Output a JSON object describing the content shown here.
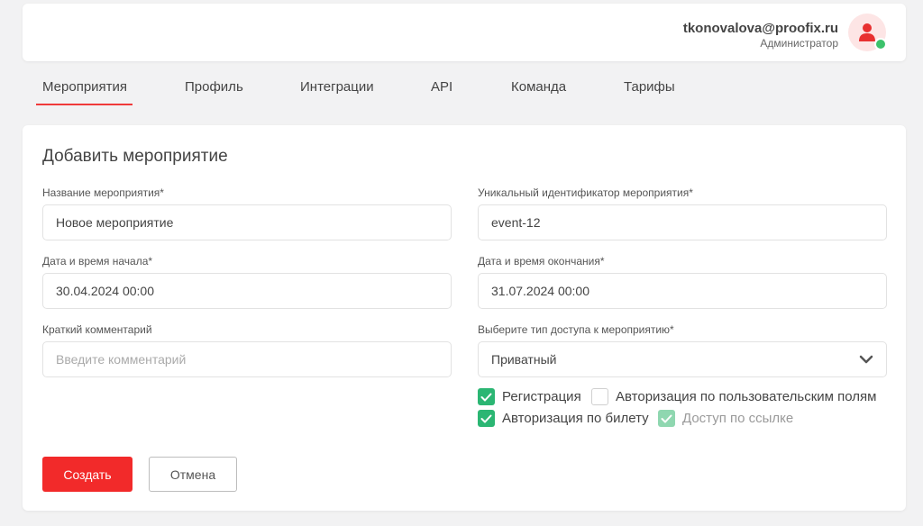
{
  "header": {
    "user_email": "tkonovalova@proofix.ru",
    "user_role": "Администратор",
    "online_status_color": "#3cc26b",
    "avatar_icon": "user-icon"
  },
  "tabs": [
    {
      "label": "Мероприятия",
      "active": true
    },
    {
      "label": "Профиль",
      "active": false
    },
    {
      "label": "Интеграции",
      "active": false
    },
    {
      "label": "API",
      "active": false
    },
    {
      "label": "Команда",
      "active": false
    },
    {
      "label": "Тарифы",
      "active": false
    }
  ],
  "form": {
    "title": "Добавить мероприятие",
    "event_name": {
      "label": "Название мероприятия*",
      "value": "Новое мероприятие"
    },
    "event_id": {
      "label": "Уникальный идентификатор мероприятия*",
      "value": "event-12"
    },
    "start": {
      "label": "Дата и время начала*",
      "value": "30.04.2024 00:00"
    },
    "end": {
      "label": "Дата и время окончания*",
      "value": "31.07.2024 00:00"
    },
    "comment": {
      "label": "Краткий комментарий",
      "value": "",
      "placeholder": "Введите комментарий"
    },
    "access": {
      "label": "Выберите тип доступа к мероприятию*",
      "value": "Приватный"
    },
    "checkboxes": [
      {
        "label": "Регистрация",
        "checked": true,
        "disabled": false
      },
      {
        "label": "Авторизация по пользовательским полям",
        "checked": false,
        "disabled": false
      },
      {
        "label": "Авторизация по билету",
        "checked": true,
        "disabled": false
      },
      {
        "label": "Доступ по ссылке",
        "checked": true,
        "disabled": true
      }
    ],
    "create_label": "Создать",
    "cancel_label": "Отмена"
  },
  "colors": {
    "accent": "#f22a2a",
    "checkbox": "#2bb673"
  }
}
